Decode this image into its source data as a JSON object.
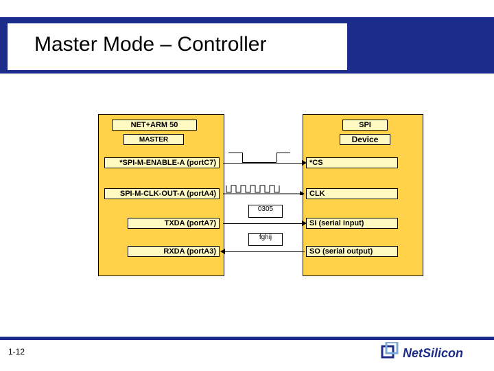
{
  "title": "Master Mode – Controller",
  "slide_number": "1-12",
  "master": {
    "chip": "NET+ARM 50",
    "role": "MASTER",
    "enable": "*SPI-M-ENABLE-A (portC7)",
    "clock": "SPI-M-CLK-OUT-A (portA4)",
    "txda": "TXDA (portA7)",
    "rxda": "RXDA (portA3)"
  },
  "slave": {
    "chip": "SPI",
    "role": "Device",
    "cs": "*CS",
    "clk": "CLK",
    "si": "SI (serial input)",
    "so": "SO (serial output)"
  },
  "data_box_tx": "0305",
  "data_box_rx": "fghij",
  "logo_text": "NetSilicon",
  "colors": {
    "brand": "#1b2c8a",
    "panel": "#ffd24a",
    "label": "#fff9c2"
  }
}
